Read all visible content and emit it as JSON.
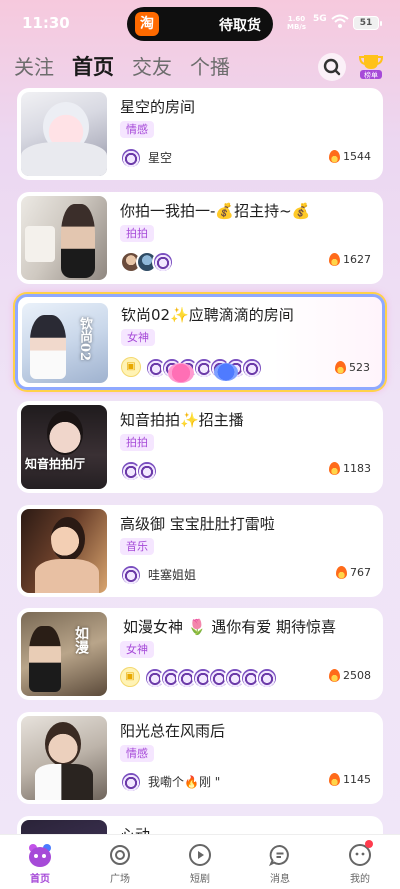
{
  "status_bar": {
    "time": "11:30",
    "island_app_icon": "淘",
    "island_text": "待取货",
    "net_speed_value": "1.60",
    "net_speed_unit": "MB/s",
    "signal": "5G",
    "battery": "51"
  },
  "top_nav": {
    "tabs": [
      {
        "label": "关注"
      },
      {
        "label": "首页"
      },
      {
        "label": "交友"
      },
      {
        "label": "个播"
      }
    ],
    "active_index": 1,
    "search_icon": "search-icon",
    "rank_icon": "rank-trophy-icon",
    "rank_label": "榜单"
  },
  "rooms": [
    {
      "title": "星空的房间",
      "tag": "情感",
      "host": "星空",
      "heat": "1544"
    },
    {
      "title": "你拍一我拍一-💰招主持~💰",
      "tag": "拍拍",
      "host": "",
      "heat": "1627"
    },
    {
      "title": "钦尚02✨应聘滴滴的房间",
      "tag": "女神",
      "host": "",
      "heat": "523",
      "thumb_caption": "钦尚02"
    },
    {
      "title": "知音拍拍✨招主播",
      "tag": "拍拍",
      "host": "",
      "heat": "1183",
      "thumb_caption": "知音拍拍厅"
    },
    {
      "title": "高级御 宝宝肚肚打雷啦",
      "tag": "音乐",
      "host": "哇塞姐姐",
      "heat": "767"
    },
    {
      "title": "如漫女神 🌷 遇你有爱 期待惊喜",
      "tag": "女神",
      "host": "",
      "heat": "2508",
      "thumb_caption": "如漫"
    },
    {
      "title": "阳光总在风雨后",
      "tag": "情感",
      "host": "我嘞个🔥刚 \"",
      "heat": "1145"
    },
    {
      "title": "心动",
      "tag": "",
      "host": "",
      "heat": ""
    }
  ],
  "bottom_nav": {
    "items": [
      {
        "label": "首页",
        "icon": "home-bear-icon"
      },
      {
        "label": "广场",
        "icon": "plaza-icon"
      },
      {
        "label": "短剧",
        "icon": "play-icon"
      },
      {
        "label": "消息",
        "icon": "message-icon"
      },
      {
        "label": "我的",
        "icon": "profile-icon"
      }
    ],
    "active_index": 0
  },
  "colors": {
    "accent": "#a64ad8",
    "tag_bg": "#f5e6ff",
    "featured_border": "#8fa9ff"
  }
}
